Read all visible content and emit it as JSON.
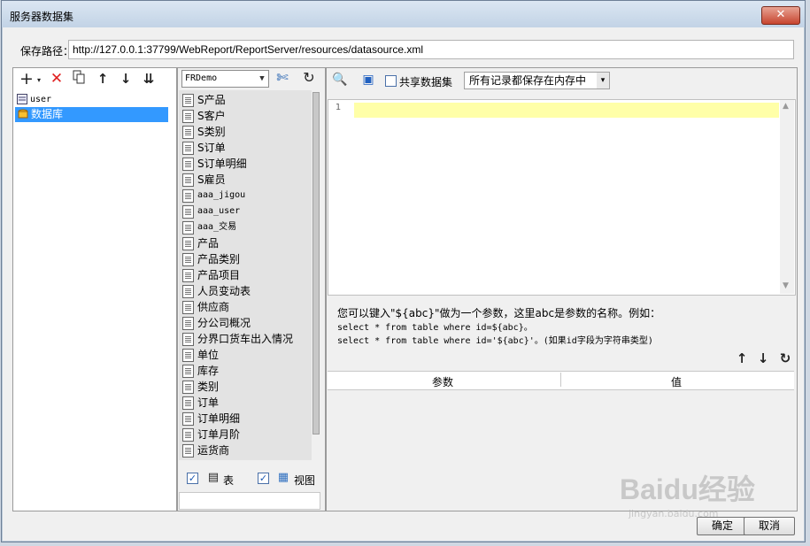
{
  "window": {
    "title": "服务器数据集"
  },
  "path": {
    "label": "保存路径：",
    "value": "http://127.0.0.1:37799/WebReport/ReportServer/resources/datasource.xml"
  },
  "left_tree": {
    "items": [
      {
        "label": "user",
        "icon": "dataset-icon",
        "selected": false
      },
      {
        "label": "数据库",
        "icon": "database-query-icon",
        "selected": true
      }
    ]
  },
  "connection": {
    "selected": "FRDemo"
  },
  "tables": [
    "S产品",
    "S客户",
    "S类别",
    "S订单",
    "S订单明细",
    "S雇员",
    "aaa_jigou",
    "aaa_user",
    "aaa_交易",
    "产品",
    "产品类别",
    "产品项目",
    "人员变动表",
    "供应商",
    "分公司概况",
    "分界口货车出入情况",
    "单位",
    "库存",
    "类别",
    "订单",
    "订单明细",
    "订单月阶",
    "运货商"
  ],
  "filters": {
    "table_label": "表",
    "view_label": "视图"
  },
  "sql_toolbar": {
    "share_label": "共享数据集",
    "storage_option": "所有记录都保存在内存中"
  },
  "editor": {
    "line_number": "1"
  },
  "hint": {
    "line1": "您可以键入\"${abc}\"做为一个参数，这里abc是参数的名称。例如：",
    "line2": "select * from table where id=${abc}。",
    "line3": "select * from table where id='${abc}'。(如果id字段为字符串类型)"
  },
  "params": {
    "col_param": "参数",
    "col_value": "值"
  },
  "buttons": {
    "ok": "确定",
    "cancel": "取消"
  },
  "watermark": {
    "logo": "Baidu经验",
    "url": "jingyan.baidu.com"
  }
}
